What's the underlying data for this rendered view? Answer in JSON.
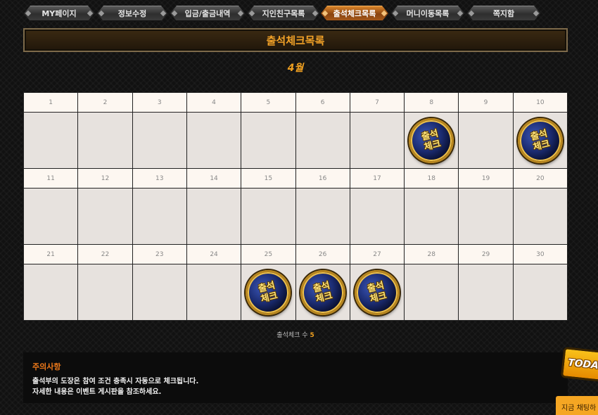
{
  "tabs": [
    {
      "label": "MY페이지",
      "active": false
    },
    {
      "label": "정보수정",
      "active": false
    },
    {
      "label": "입금/출금내역",
      "active": false
    },
    {
      "label": "지인친구목록",
      "active": false
    },
    {
      "label": "출석체크목록",
      "active": true
    },
    {
      "label": "머니이동목록",
      "active": false
    },
    {
      "label": "쪽지함",
      "active": false
    }
  ],
  "page_title": "출석체크목록",
  "month": "4월",
  "calendar": {
    "weeks": [
      {
        "days": [
          "1",
          "2",
          "3",
          "4",
          "5",
          "6",
          "7",
          "8",
          "9",
          "10"
        ],
        "checked": [
          false,
          false,
          false,
          false,
          false,
          false,
          false,
          true,
          false,
          true
        ]
      },
      {
        "days": [
          "11",
          "12",
          "13",
          "14",
          "15",
          "16",
          "17",
          "18",
          "19",
          "20"
        ],
        "checked": [
          false,
          false,
          false,
          false,
          false,
          false,
          false,
          false,
          false,
          false
        ]
      },
      {
        "days": [
          "21",
          "22",
          "23",
          "24",
          "25",
          "26",
          "27",
          "28",
          "29",
          "30"
        ],
        "checked": [
          false,
          false,
          false,
          false,
          true,
          true,
          true,
          false,
          false,
          false
        ]
      }
    ],
    "stamp_text": [
      "출석",
      "체크"
    ]
  },
  "count": {
    "label": "출석체크 수",
    "value": "5"
  },
  "notice": {
    "title": "주의사항",
    "lines": [
      "출석부의 도장은 참여 조건 충족시 자동으로 체크됩니다.",
      "자세한 내용은 이벤트 게시판을 참조하세요."
    ]
  },
  "today_badge": "TODAY",
  "chat_label": "지금 채팅하"
}
